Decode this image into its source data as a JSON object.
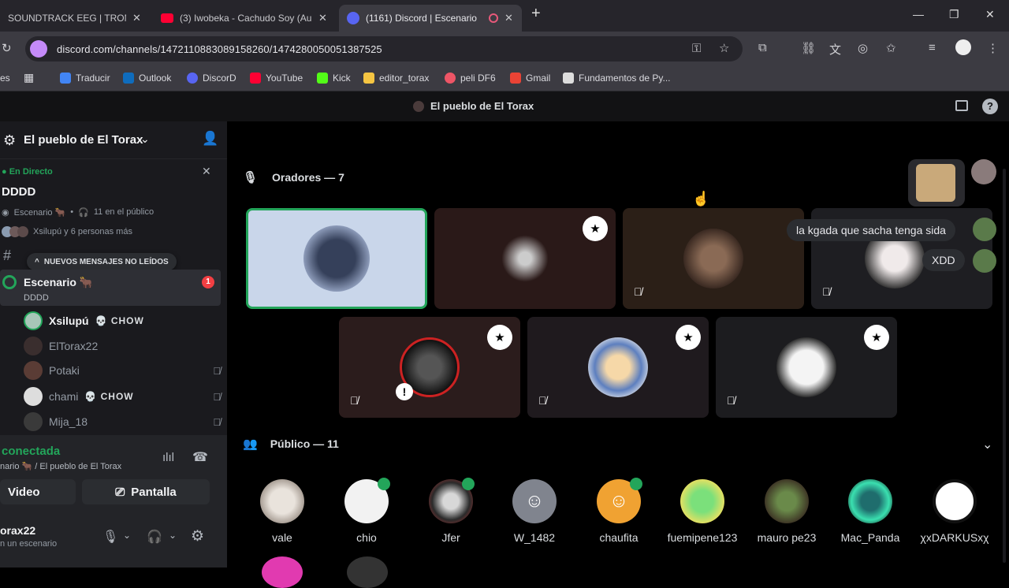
{
  "browser": {
    "tabs": [
      {
        "title": "SOUNDTRACK EEG | TROMP",
        "close": "✕"
      },
      {
        "title": "(3) Iwobeka - Cachudo Soy (Au",
        "close": "✕"
      },
      {
        "title": "(1161) Discord | Escenario",
        "close": "✕"
      }
    ],
    "new_tab": "+",
    "url": "discord.com/channels/1472110883089158260/1474280050051387525",
    "bookmarks": [
      {
        "label": "Traducir"
      },
      {
        "label": "Outlook"
      },
      {
        "label": "DiscorD"
      },
      {
        "label": "YouTube"
      },
      {
        "label": "Kick"
      },
      {
        "label": "editor_torax"
      },
      {
        "label": "peli DF6"
      },
      {
        "label": "Gmail"
      },
      {
        "label": "Fundamentos de Py..."
      }
    ],
    "bookmarks_prefix": "es"
  },
  "discord": {
    "top_title": "El pueblo de El Torax",
    "server_name": "El pueblo de El Torax",
    "live": {
      "status": "En Directo",
      "stage_name": "DDDD",
      "meta_stage": "Escenario 🐂",
      "meta_audience": "11 en el público",
      "meta_people": "Xsilupú y 6 personas más"
    },
    "new_messages_pill": "NUEVOS MENSAJES NO LEÍDOS",
    "channel_stub": "#",
    "channel": {
      "name": "Escenario 🐂",
      "sub": "DDDD",
      "badge": "1"
    },
    "members": [
      {
        "name": "Xsilupú",
        "tag": "CHOW"
      },
      {
        "name": "ElTorax22",
        "tag": ""
      },
      {
        "name": "Potaki",
        "tag": ""
      },
      {
        "name": "chami",
        "tag": "CHOW"
      },
      {
        "name": "Mija_18",
        "tag": ""
      }
    ],
    "voice": {
      "status": "conectada",
      "location": "nario 🐂 / El pueblo de El Torax"
    },
    "buttons": {
      "video": "Video",
      "screen": "Pantalla"
    },
    "user": {
      "name": "orax22",
      "sub": "n un escenario"
    },
    "speakers_header": "Oradores — 7",
    "audience_header": "Público — 11",
    "chat_bubbles": [
      "la kgada que sacha tenga sida",
      "XDD"
    ],
    "audience": [
      "vale",
      "chio",
      "Jfer",
      "W_1482",
      "chaufita",
      "fuemipene123",
      "mauro pe23",
      "Mac_Panda",
      "χxDARKUSxχ"
    ]
  },
  "colors": {
    "accent_green": "#23a55a",
    "badge_red": "#f23f43",
    "blurple": "#5865f2"
  }
}
